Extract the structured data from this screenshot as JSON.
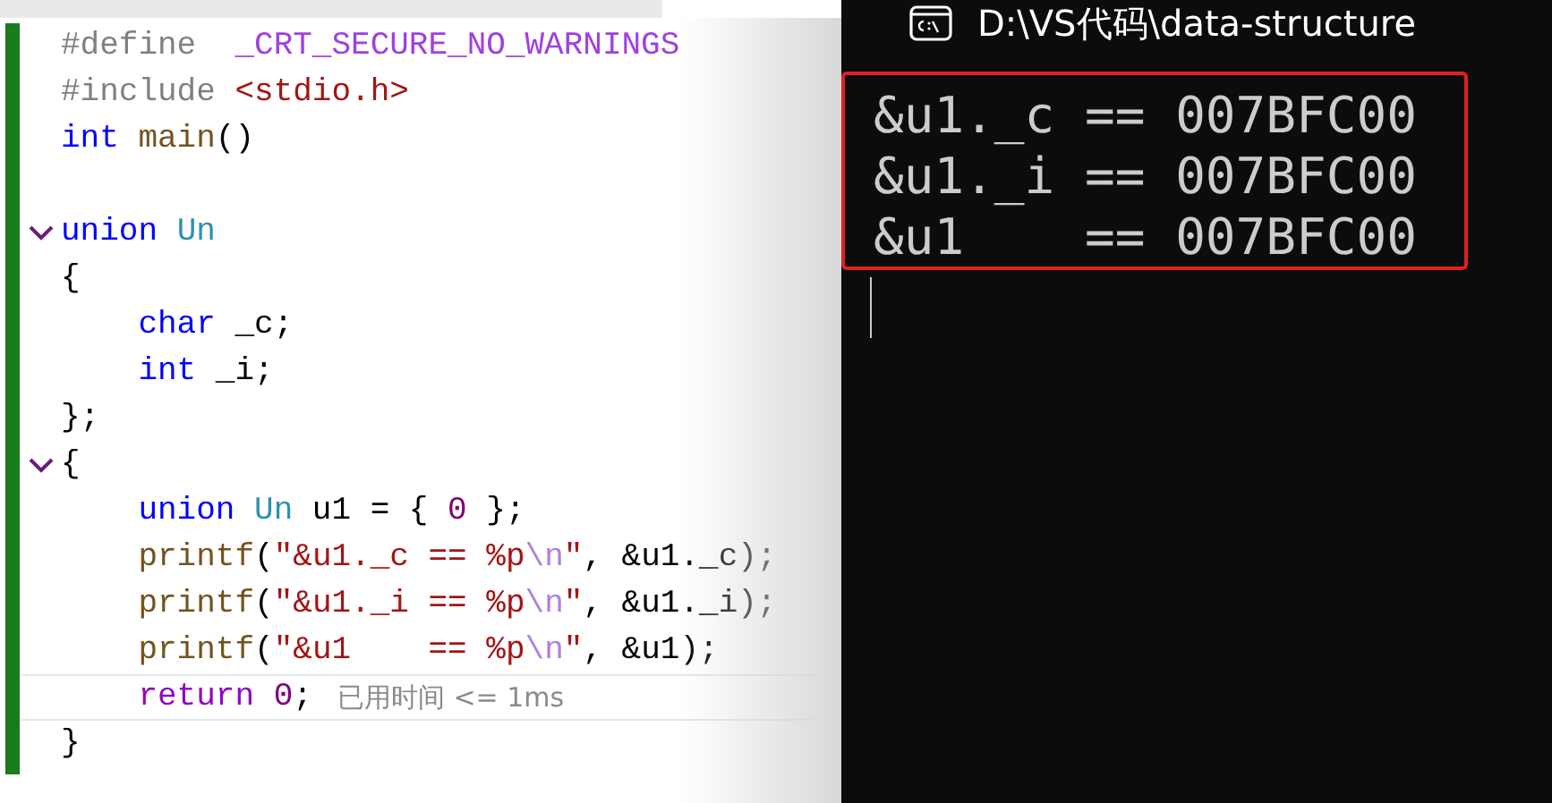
{
  "editor": {
    "lines": [
      {
        "fold": false,
        "current": false,
        "tokens": [
          {
            "kind": "preproc",
            "text": "#define  "
          },
          {
            "kind": "macro",
            "text": "_CRT_SECURE_NO_WARNINGS"
          }
        ]
      },
      {
        "fold": false,
        "current": false,
        "tokens": [
          {
            "kind": "preproc",
            "text": "#include "
          },
          {
            "kind": "string",
            "text": "<stdio.h>"
          }
        ]
      },
      {
        "fold": false,
        "current": false,
        "tokens": [
          {
            "kind": "keyword",
            "text": "int"
          },
          {
            "kind": "func",
            "text": " main"
          },
          {
            "kind": "plain",
            "text": "()"
          }
        ]
      },
      {
        "fold": false,
        "current": false
      },
      {
        "fold": true,
        "current": false,
        "tokens": [
          {
            "kind": "keyword",
            "text": "union"
          },
          {
            "kind": "type",
            "text": " Un"
          }
        ]
      },
      {
        "fold": false,
        "current": false,
        "tokens": [
          {
            "kind": "plain",
            "text": "{"
          }
        ]
      },
      {
        "fold": false,
        "current": false,
        "tokens": [
          {
            "kind": "keyword",
            "text": "    char"
          },
          {
            "kind": "plain",
            "text": " _c;"
          }
        ]
      },
      {
        "fold": false,
        "current": false,
        "tokens": [
          {
            "kind": "keyword",
            "text": "    int"
          },
          {
            "kind": "plain",
            "text": " _i;"
          }
        ]
      },
      {
        "fold": false,
        "current": false,
        "tokens": [
          {
            "kind": "plain",
            "text": "};"
          }
        ]
      },
      {
        "fold": true,
        "current": false,
        "tokens": [
          {
            "kind": "plain",
            "text": "{"
          }
        ]
      },
      {
        "fold": false,
        "current": false,
        "tokens": [
          {
            "kind": "keyword",
            "text": "    union"
          },
          {
            "kind": "type",
            "text": " Un"
          },
          {
            "kind": "plain",
            "text": " u1 = { "
          },
          {
            "kind": "number",
            "text": "0"
          },
          {
            "kind": "plain",
            "text": " };"
          }
        ]
      },
      {
        "fold": false,
        "current": false,
        "tokens": [
          {
            "kind": "func",
            "text": "    printf"
          },
          {
            "kind": "plain",
            "text": "("
          },
          {
            "kind": "string",
            "text": "\"&u1._c == %p"
          },
          {
            "kind": "escape",
            "text": "\\n"
          },
          {
            "kind": "string",
            "text": "\""
          },
          {
            "kind": "plain",
            "text": ", &u1._c);"
          }
        ]
      },
      {
        "fold": false,
        "current": false,
        "tokens": [
          {
            "kind": "func",
            "text": "    printf"
          },
          {
            "kind": "plain",
            "text": "("
          },
          {
            "kind": "string",
            "text": "\"&u1._i == %p"
          },
          {
            "kind": "escape",
            "text": "\\n"
          },
          {
            "kind": "string",
            "text": "\""
          },
          {
            "kind": "plain",
            "text": ", &u1._i);"
          }
        ]
      },
      {
        "fold": false,
        "current": false,
        "tokens": [
          {
            "kind": "func",
            "text": "    printf"
          },
          {
            "kind": "plain",
            "text": "("
          },
          {
            "kind": "string",
            "text": "\"&u1    == %p"
          },
          {
            "kind": "escape",
            "text": "\\n"
          },
          {
            "kind": "string",
            "text": "\""
          },
          {
            "kind": "plain",
            "text": ", &u1);"
          }
        ]
      },
      {
        "fold": false,
        "current": true,
        "tokens": [
          {
            "kind": "control",
            "text": "    return"
          },
          {
            "kind": "number",
            "text": " 0"
          },
          {
            "kind": "plain",
            "text": ";"
          },
          {
            "kind": "hint",
            "text": "已用时间 <= 1ms"
          }
        ]
      },
      {
        "fold": false,
        "current": false,
        "tokens": [
          {
            "kind": "plain",
            "text": "}"
          }
        ]
      }
    ]
  },
  "console": {
    "title": "D:\\VS代码\\data-structure",
    "output": [
      "&u1._c == 007BFC00",
      "&u1._i == 007BFC00",
      "&u1    == 007BFC00"
    ]
  }
}
